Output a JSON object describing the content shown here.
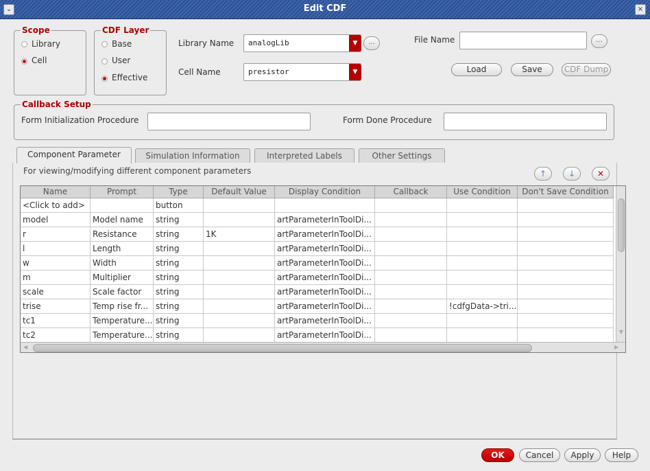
{
  "window": {
    "title": "Edit CDF",
    "menu_glyph": "⌄",
    "close_glyph": "×"
  },
  "scope": {
    "legend": "Scope",
    "options": [
      "Library",
      "Cell"
    ],
    "selected": "Cell"
  },
  "cdf_layer": {
    "legend": "CDF Layer",
    "options": [
      "Base",
      "User",
      "Effective"
    ],
    "selected": "Effective"
  },
  "library": {
    "label": "Library Name",
    "value": "analogLib"
  },
  "cell": {
    "label": "Cell Name",
    "value": "presistor"
  },
  "browse_label": "...",
  "file": {
    "label": "File Name",
    "value": ""
  },
  "file_buttons": {
    "load": "Load",
    "save": "Save",
    "cdf_dump": "CDF Dump"
  },
  "callback": {
    "legend": "Callback Setup",
    "init_label": "Form Initialization Procedure",
    "init_value": "",
    "done_label": "Form Done Procedure",
    "done_value": ""
  },
  "tabs": [
    "Component Parameter",
    "Simulation Information",
    "Interpreted Labels",
    "Other Settings"
  ],
  "active_tab": "Component Parameter",
  "panel_hint": "For viewing/modifying different component parameters",
  "row_buttons": {
    "up": "↑",
    "down": "↓",
    "delete": "✕"
  },
  "table": {
    "columns": [
      "Name",
      "Prompt",
      "Type",
      "Default Value",
      "Display Condition",
      "Callback",
      "Use Condition",
      "Don't Save Condition"
    ],
    "rows": [
      [
        "<Click to add>",
        "",
        "button",
        "",
        "",
        "",
        "",
        ""
      ],
      [
        "model",
        "Model name",
        "string",
        "",
        "artParameterInToolDi...",
        "",
        "",
        ""
      ],
      [
        "r",
        "Resistance",
        "string",
        "1K",
        "artParameterInToolDi...",
        "",
        "",
        ""
      ],
      [
        "l",
        "Length",
        "string",
        "",
        "artParameterInToolDi...",
        "",
        "",
        ""
      ],
      [
        "w",
        "Width",
        "string",
        "",
        "artParameterInToolDi...",
        "",
        "",
        ""
      ],
      [
        "m",
        "Multiplier",
        "string",
        "",
        "artParameterInToolDi...",
        "",
        "",
        ""
      ],
      [
        "scale",
        "Scale factor",
        "string",
        "",
        "artParameterInToolDi...",
        "",
        "",
        ""
      ],
      [
        "trise",
        "Temp rise fr...",
        "string",
        "",
        "artParameterInToolDi...",
        "",
        "!cdfgData->tri...",
        ""
      ],
      [
        "tc1",
        "Temperature...",
        "string",
        "",
        "artParameterInToolDi...",
        "",
        "",
        ""
      ],
      [
        "tc2",
        "Temperature...",
        "string",
        "",
        "artParameterInToolDi...",
        "",
        "",
        ""
      ]
    ]
  },
  "dialog_buttons": {
    "ok": "OK",
    "cancel": "Cancel",
    "apply": "Apply",
    "help": "Help"
  },
  "colors": {
    "accent": "#b00000",
    "titlebar": "#2d4f92",
    "background": "#ececec"
  }
}
